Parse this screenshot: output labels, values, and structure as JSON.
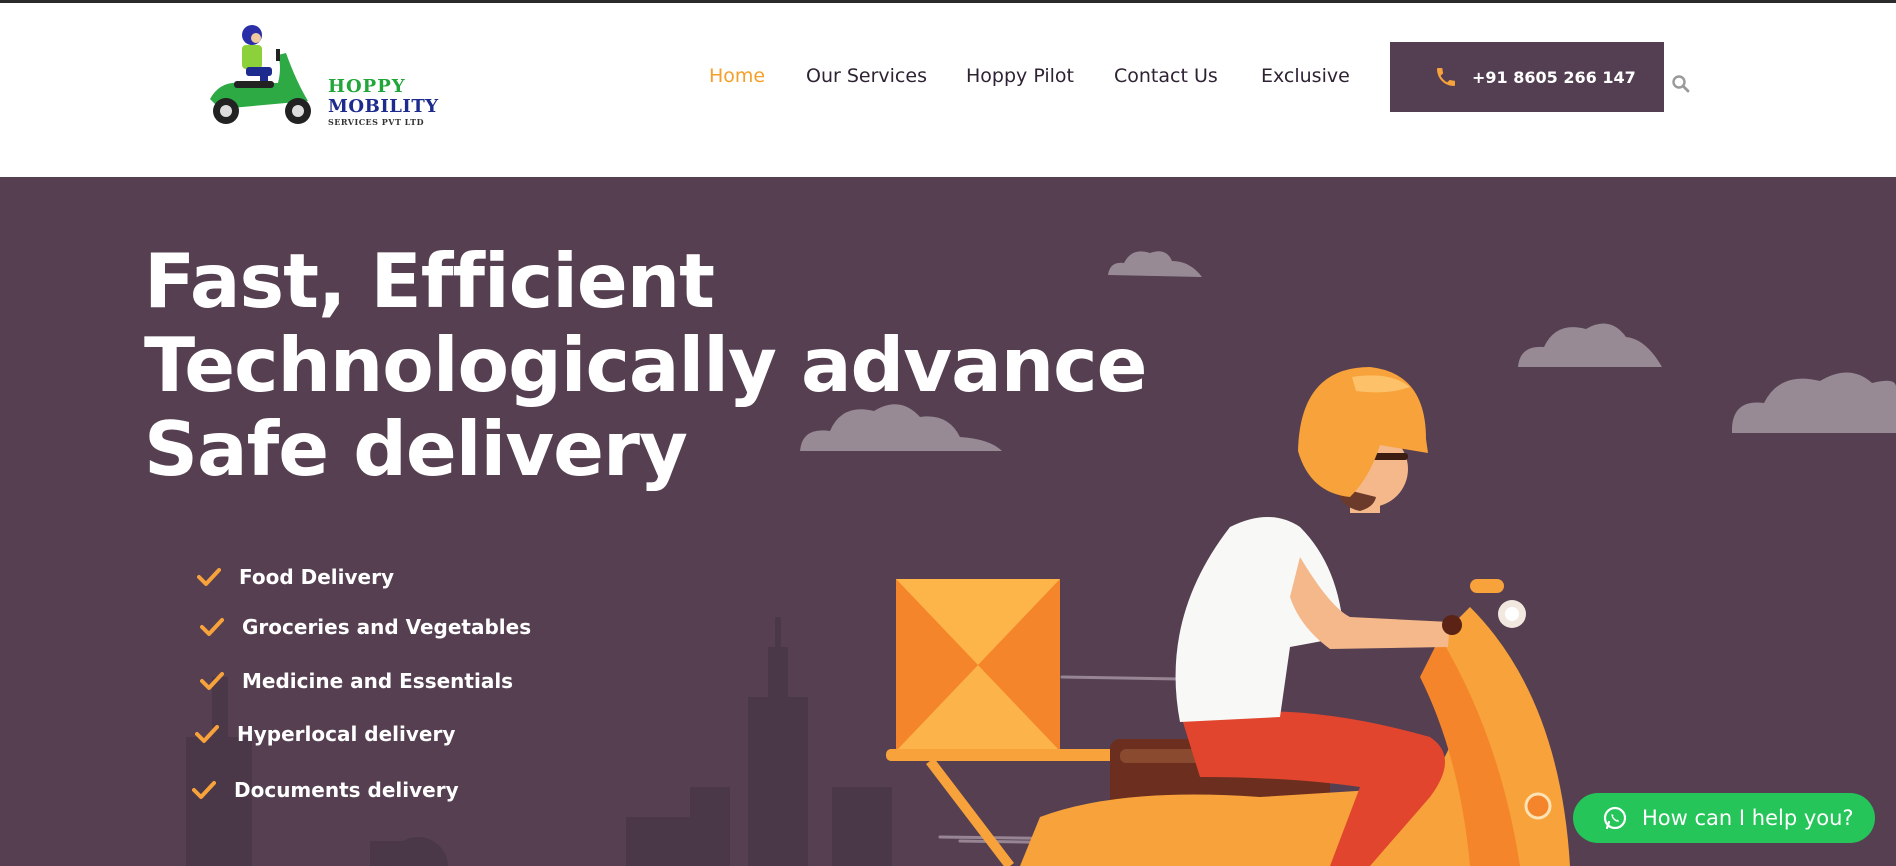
{
  "brand": {
    "line1": "HOPPY",
    "line2": "MOBILITY",
    "line3": "SERVICES PVT LTD",
    "green": "#21a63a",
    "blue": "#1d2b8f"
  },
  "nav": {
    "items": [
      {
        "label": "Home",
        "active": true
      },
      {
        "label": "Our Services",
        "active": false
      },
      {
        "label": "Hoppy Pilot",
        "active": false
      },
      {
        "label": "Contact Us",
        "active": false
      },
      {
        "label": "Exclusive",
        "active": false
      }
    ],
    "active_color": "#f5a02a"
  },
  "phone": {
    "number": "+91 8605 266 147",
    "icon": "phone-icon"
  },
  "search": {
    "icon": "search-icon"
  },
  "hero": {
    "headline": [
      "Fast, Efficient",
      "Technologically advance",
      "Safe delivery"
    ],
    "features": [
      "Food Delivery",
      "Groceries and Vegetables",
      "Medicine and Essentials",
      "Hyperlocal delivery",
      "Documents delivery"
    ],
    "background": "#553f51",
    "accent": "#f7a23a"
  },
  "whatsapp": {
    "label": "How can I help you?",
    "icon": "whatsapp-icon",
    "color": "#25c55a"
  }
}
